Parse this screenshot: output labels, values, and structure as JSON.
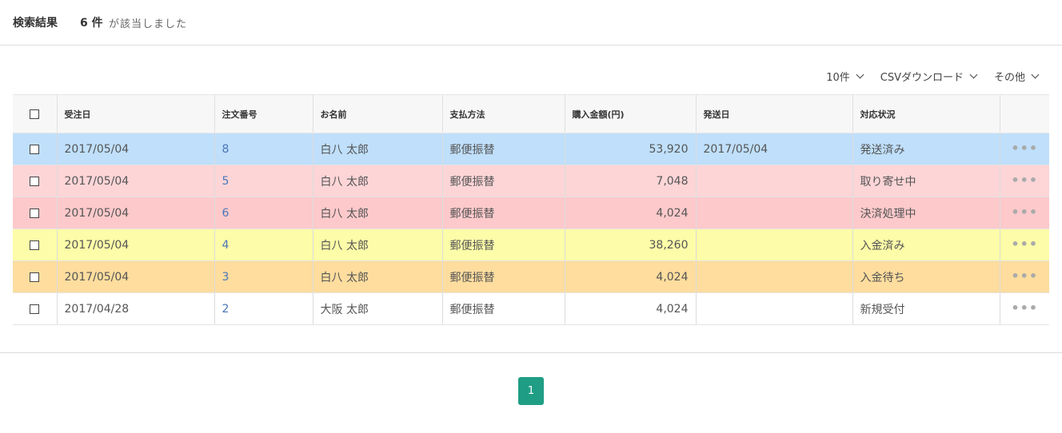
{
  "header": {
    "title": "検索結果",
    "count": "6 件",
    "count_text": "が該当しました"
  },
  "toolbar": {
    "per_page": "10件",
    "csv": "CSVダウンロード",
    "other": "その他"
  },
  "table": {
    "columns": [
      "受注日",
      "注文番号",
      "お名前",
      "支払方法",
      "購入金額(円)",
      "発送日",
      "対応状況"
    ],
    "rows": [
      {
        "date": "2017/05/04",
        "order_no": "8",
        "name": "白八 太郎",
        "payment": "郵便振替",
        "amount": "53,920",
        "ship_date": "2017/05/04",
        "status": "発送済み",
        "row_color": "#bfdffb"
      },
      {
        "date": "2017/05/04",
        "order_no": "5",
        "name": "白八 太郎",
        "payment": "郵便振替",
        "amount": "7,048",
        "ship_date": "",
        "status": "取り寄せ中",
        "row_color": "#fdd5d7"
      },
      {
        "date": "2017/05/04",
        "order_no": "6",
        "name": "白八 太郎",
        "payment": "郵便振替",
        "amount": "4,024",
        "ship_date": "",
        "status": "決済処理中",
        "row_color": "#fdc9cb"
      },
      {
        "date": "2017/05/04",
        "order_no": "4",
        "name": "白八 太郎",
        "payment": "郵便振替",
        "amount": "38,260",
        "ship_date": "",
        "status": "入金済み",
        "row_color": "#fdfca8"
      },
      {
        "date": "2017/05/04",
        "order_no": "3",
        "name": "白八 太郎",
        "payment": "郵便振替",
        "amount": "4,024",
        "ship_date": "",
        "status": "入金待ち",
        "row_color": "#fedd9e"
      },
      {
        "date": "2017/04/28",
        "order_no": "2",
        "name": "大阪 太郎",
        "payment": "郵便振替",
        "amount": "4,024",
        "ship_date": "",
        "status": "新規受付",
        "row_color": "#ffffff"
      }
    ],
    "more_glyph": "•••"
  },
  "pagination": {
    "current": "1"
  },
  "colors": {
    "accent": "#1f9e85",
    "link": "#4a76b8"
  }
}
